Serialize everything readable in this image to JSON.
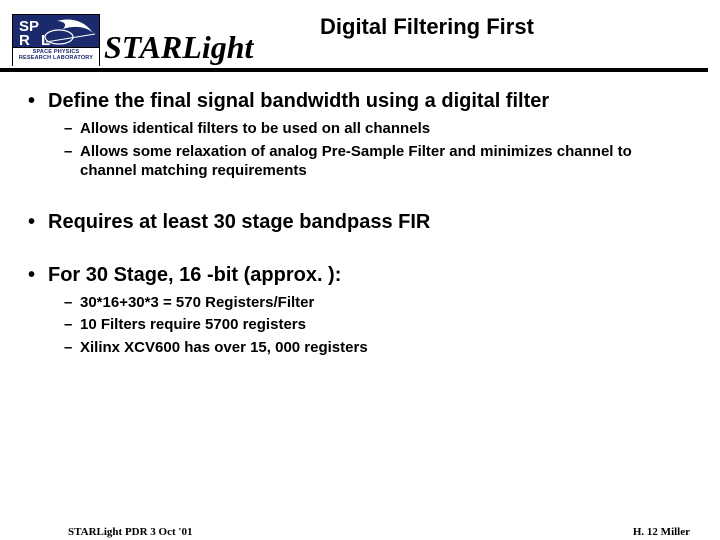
{
  "header": {
    "brand": "STARLight",
    "title": "Digital Filtering First",
    "logo_line1": "SPACE PHYSICS",
    "logo_line2": "RESEARCH LABORATORY"
  },
  "bullets": [
    {
      "text": "Define the final signal bandwidth using a digital filter",
      "sub": [
        "Allows identical filters to be used on all channels",
        "Allows some relaxation of analog Pre-Sample Filter and minimizes channel to channel matching requirements"
      ]
    },
    {
      "text": "Requires at least 30 stage bandpass FIR",
      "sub": []
    },
    {
      "text": "For 30 Stage, 16 -bit (approx. ):",
      "sub": [
        "30*16+30*3 = 570 Registers/Filter",
        "10 Filters require 5700 registers",
        "Xilinx XCV600 has over 15, 000 registers"
      ]
    }
  ],
  "footer": {
    "left": "STARLight PDR 3 Oct '01",
    "right": "H. 12 Miller"
  }
}
